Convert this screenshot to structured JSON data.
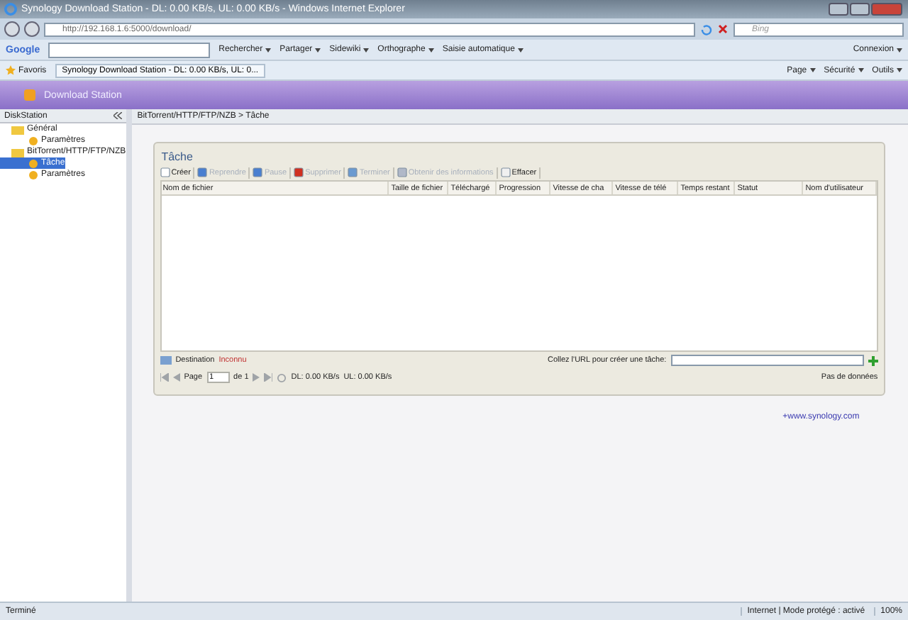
{
  "window": {
    "title": "Synology Download Station - DL: 0.00 KB/s, UL: 0.00 KB/s - Windows Internet Explorer"
  },
  "address_bar": {
    "url": "http://192.168.1.6:5000/download/",
    "search_placeholder": "Bing"
  },
  "google_toolbar": {
    "brand": "Google",
    "items": [
      "Rechercher",
      "Partager",
      "Sidewiki",
      "Orthographe",
      "Saisie automatique"
    ],
    "sign_in": "Connexion"
  },
  "favorites_bar": {
    "favorites": "Favoris",
    "tab": "Synology Download Station - DL: 0.00 KB/s, UL: 0...",
    "commands": [
      "Page",
      "Sécurité",
      "Outils"
    ]
  },
  "app": {
    "title": "Download Station"
  },
  "sidebar": {
    "title": "DiskStation",
    "tree": [
      {
        "label": "Général",
        "selected": false,
        "children": [
          {
            "label": "Paramètres",
            "selected": false
          }
        ]
      },
      {
        "label": "BitTorrent/HTTP/FTP/NZB",
        "selected": false,
        "children": [
          {
            "label": "Tâche",
            "selected": true
          },
          {
            "label": "Paramètres",
            "selected": false
          }
        ]
      }
    ]
  },
  "breadcrumb": "BitTorrent/HTTP/FTP/NZB > Tâche",
  "panel": {
    "title": "Tâche",
    "toolbar": [
      {
        "label": "Créer",
        "kind": "create",
        "disabled": false
      },
      {
        "label": "Reprendre",
        "kind": "resume",
        "disabled": true
      },
      {
        "label": "Pause",
        "kind": "pause",
        "disabled": true
      },
      {
        "label": "Supprimer",
        "kind": "delete",
        "disabled": true
      },
      {
        "label": "Terminer",
        "kind": "finish",
        "disabled": true
      },
      {
        "label": "Obtenir des informations",
        "kind": "info",
        "disabled": true
      },
      {
        "label": "Effacer",
        "kind": "clear",
        "disabled": false
      }
    ],
    "columns": [
      "Nom de fichier",
      "Taille de fichier",
      "Téléchargé",
      "Progression",
      "Vitesse de cha",
      "Vitesse de télé",
      "Temps restant",
      "Statut",
      "Nom d'utilisateur"
    ],
    "destination_label": "Destination",
    "destination_value": "Inconnu",
    "url_prompt": "Collez l'URL pour créer une tâche:",
    "paging": {
      "page_label": "Page",
      "page_value": "1",
      "page_total": "de 1",
      "dl": "DL:  0.00 KB/s",
      "ul": "UL:  0.00 KB/s",
      "empty": "Pas de données"
    }
  },
  "link": "+www.synology.com",
  "status_bar": {
    "text": "Terminé",
    "zone": "Internet | Mode protégé : activé",
    "zoom": "100%"
  }
}
